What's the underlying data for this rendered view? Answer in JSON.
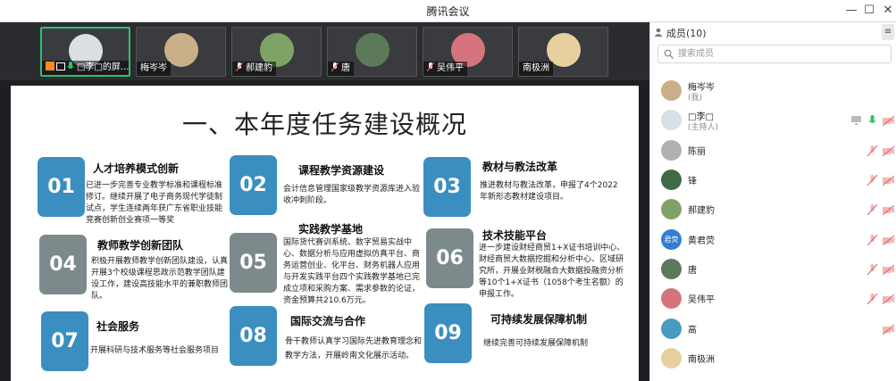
{
  "window": {
    "title": "腾讯会议",
    "controls": {
      "minimize": "—",
      "maximize": "☐",
      "close": "✕"
    }
  },
  "video_strip": [
    {
      "name": "□李□的屏...",
      "active": true
    },
    {
      "name": "梅岑岑",
      "active": false
    },
    {
      "name": "郝建豹",
      "active": false
    },
    {
      "name": "唐",
      "active": false
    },
    {
      "name": "吴伟平",
      "active": false
    },
    {
      "name": "南极洲",
      "active": false
    }
  ],
  "slide": {
    "title": "一、本年度任务建设概况",
    "items": [
      {
        "num": "01",
        "head": "人才培养模式创新",
        "desc": "已进一步完善专业教学标准和课程标准修订。继续开展了电子商务现代学徒制试点，学生连续两年获广东省职业技能竞赛创新创业赛项一等奖"
      },
      {
        "num": "02",
        "head": "课程教学资源建设",
        "desc": "会计信息管理国家级教学资源库进入验收冲刺阶段。"
      },
      {
        "num": "03",
        "head": "教材与教法改革",
        "desc": "推进教材与教法改革，申报了4个2022年新形态教材建设项目。"
      },
      {
        "num": "04",
        "head": "教师教学创新团队",
        "desc": "积极开展教师教学创新团队建设，认真开展3个校级课程思政示范教学团队建设工作，建设高技能水平的兼职教师团队。"
      },
      {
        "num": "05",
        "head": "实践教学基地",
        "desc": "国际货代赛训系统、数字贸易实战中心、数据分析与应用虚拟仿真平台、商务运营创业、化平台、财务机器人应用与开发实践平台四个实践教学基地已完成立项和采购方案、需求参数的论证，资金预算共210.6万元。"
      },
      {
        "num": "06",
        "head": "技术技能平台",
        "desc": "进一步建设财经商贸1+X证书培训中心、财经商贸大数据挖掘和分析中心、区域研究所，开展业财税融合大数据投融资分析等10个1+X证书（1058个考生名额）的申报工作。"
      },
      {
        "num": "07",
        "head": "社会服务",
        "desc": "开展科研与技术服务等社会服务项目"
      },
      {
        "num": "08",
        "head": "国际交流与合作",
        "desc": "骨干教师认真学习国际先进教育理念和教学方法，开展岭南文化展示活动。"
      },
      {
        "num": "09",
        "head": "可持续发展保障机制",
        "desc": "继续完善可持续发展保障机制"
      }
    ]
  },
  "sidebar": {
    "title": "成员(10)",
    "menu_icon": "≡",
    "search_placeholder": "搜索成员",
    "members": [
      {
        "name": "梅岑岑",
        "role": "(我)",
        "avatar": ""
      },
      {
        "name": "□李□",
        "role": "(主持人)",
        "avatar": ""
      },
      {
        "name": "陈丽",
        "role": "",
        "avatar": ""
      },
      {
        "name": "锋",
        "role": "",
        "avatar": ""
      },
      {
        "name": "郝建豹",
        "role": "",
        "avatar": ""
      },
      {
        "name": "黄君荧",
        "role": "",
        "avatar": "君荧"
      },
      {
        "name": "唐",
        "role": "",
        "avatar": ""
      },
      {
        "name": "吴伟平",
        "role": "",
        "avatar": ""
      },
      {
        "name": "高",
        "role": "",
        "avatar": ""
      },
      {
        "name": "南极洲",
        "role": "",
        "avatar": ""
      }
    ]
  },
  "colors": {
    "blue_box": "#3a8fc0",
    "gray_box": "#7d8a8c",
    "muted_red": "#e05a5a",
    "active_green": "#2cc26c"
  }
}
